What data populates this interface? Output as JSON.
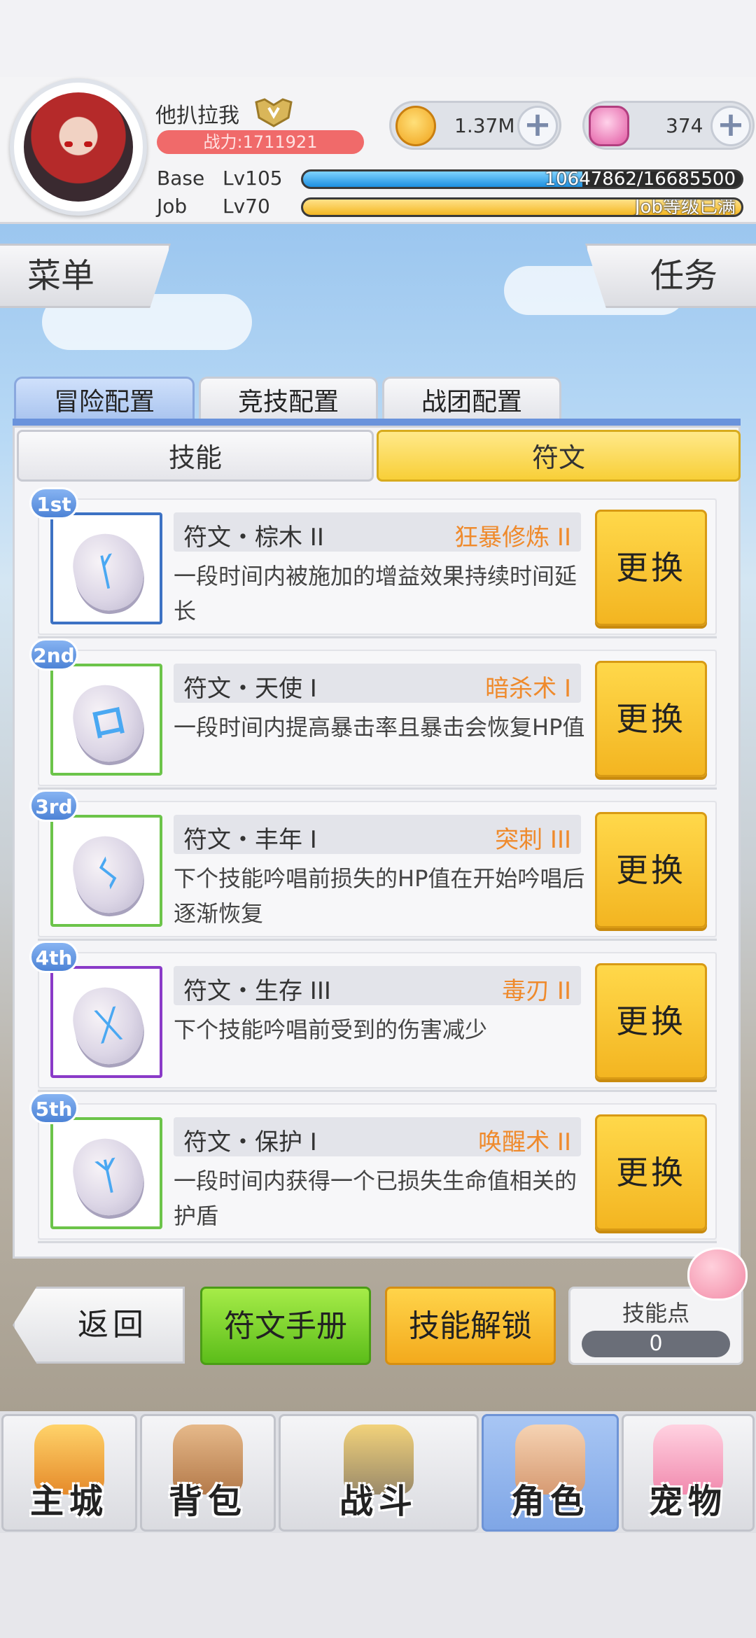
{
  "player": {
    "name": "他扒拉我",
    "power": "战力:1711921",
    "base_label": "Base",
    "base_lv": "Lv105",
    "base_exp": "10647862/16685500",
    "base_fill": 0.638,
    "job_label": "Job",
    "job_lv": "Lv70",
    "job_exp": "Job等级已满",
    "job_fill": 1.0
  },
  "currency": {
    "gold": "1.37M",
    "gem": "374",
    "plus": "+"
  },
  "side": {
    "menu": "菜单",
    "task": "任务"
  },
  "tabs": [
    "冒险配置",
    "竞技配置",
    "战团配置"
  ],
  "subtabs": [
    "技能",
    "符文"
  ],
  "runes": [
    {
      "rank": "1st",
      "name": "符文・棕木 II",
      "skill": "狂暴修炼 II",
      "desc": "一段时间内被施加的增益效果持续时间延长",
      "glyph": "ᚴ",
      "border": "#3d72c4"
    },
    {
      "rank": "2nd",
      "name": "符文・天使 I",
      "skill": "暗杀术 I",
      "desc": "一段时间内提高暴击率且暴击会恢复HP值",
      "glyph": "ロ",
      "border": "#6cc44a"
    },
    {
      "rank": "3rd",
      "name": "符文・丰年 I",
      "skill": "突刺 III",
      "desc": "下个技能吟唱前损失的HP值在开始吟唱后逐渐恢复",
      "glyph": "ᛊ",
      "border": "#6cc44a"
    },
    {
      "rank": "4th",
      "name": "符文・生存 III",
      "skill": "毒刃 II",
      "desc": "下个技能吟唱前受到的伤害减少",
      "glyph": "ᚷ",
      "border": "#8a3ac8"
    },
    {
      "rank": "5th",
      "name": "符文・保护 I",
      "skill": "唤醒术 II",
      "desc": "一段时间内获得一个已损失生命值相关的护盾",
      "glyph": "ᛉ",
      "border": "#6cc44a"
    }
  ],
  "swap_label": "更换",
  "actions": {
    "back": "返回",
    "manual": "符文手册",
    "unlock": "技能解锁",
    "skill_points_label": "技能点",
    "skill_points": "0"
  },
  "nav": [
    "主城",
    "背包",
    "战斗",
    "角色",
    "宠物"
  ],
  "nav_active": 3
}
